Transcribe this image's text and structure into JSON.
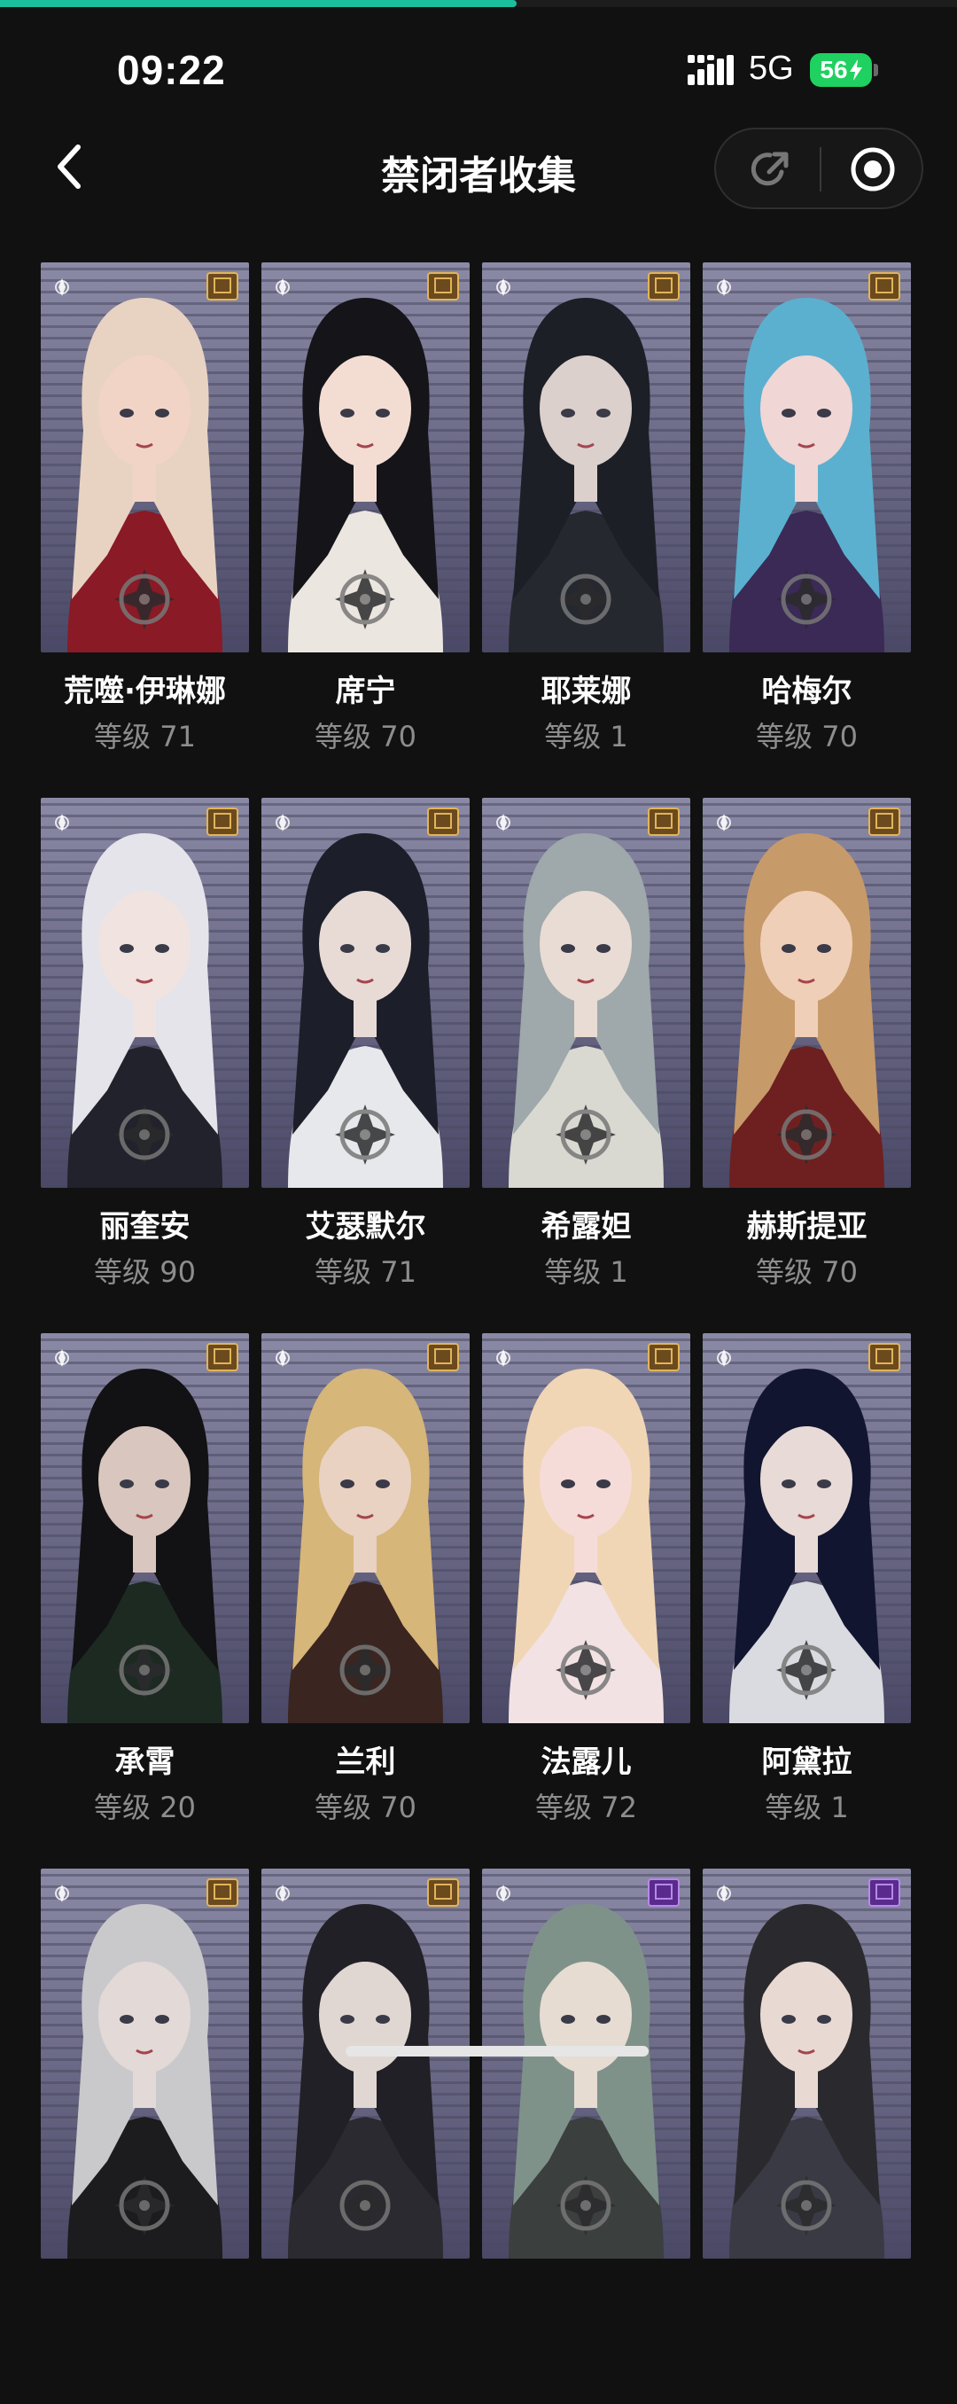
{
  "progress": {
    "value_percent": 60,
    "color": "#1bbf9c"
  },
  "status_bar": {
    "time": "09:22",
    "network": "5G",
    "battery": "56"
  },
  "header": {
    "title": "禁闭者收集",
    "back_icon": "chevron-left-icon",
    "share_icon": "share-icon",
    "record_icon": "record-icon"
  },
  "characters": [
    {
      "name": "荒噬·伊琳娜",
      "level": "等级 71",
      "hair": "#e8d3c2",
      "outfit": "#8a1a25",
      "skin": "#f2d4c6",
      "rank": "gold"
    },
    {
      "name": "席宁",
      "level": "等级 70",
      "hair": "#141419",
      "outfit": "#ece6e0",
      "skin": "#f3ddd2",
      "rank": "gold"
    },
    {
      "name": "耶莱娜",
      "level": "等级 1",
      "hair": "#1d1f27",
      "outfit": "#262830",
      "skin": "#dcd0cc",
      "rank": "gold"
    },
    {
      "name": "哈梅尔",
      "level": "等级 70",
      "hair": "#5bb0cf",
      "outfit": "#3a2a55",
      "skin": "#f0d6d4",
      "rank": "gold"
    },
    {
      "name": "丽奎安",
      "level": "等级 90",
      "hair": "#e4e4ea",
      "outfit": "#22222c",
      "skin": "#f1e3e0",
      "rank": "gold"
    },
    {
      "name": "艾瑟默尔",
      "level": "等级 71",
      "hair": "#1c1e2a",
      "outfit": "#e7e8ec",
      "skin": "#e8dbd6",
      "rank": "gold"
    },
    {
      "name": "希露妲",
      "level": "等级 1",
      "hair": "#9fa8aa",
      "outfit": "#d9d9d2",
      "skin": "#e9dcd4",
      "rank": "gold"
    },
    {
      "name": "赫斯提亚",
      "level": "等级 70",
      "hair": "#c79a6a",
      "outfit": "#6e2020",
      "skin": "#f0cfb8",
      "rank": "gold"
    },
    {
      "name": "承霄",
      "level": "等级 20",
      "hair": "#121214",
      "outfit": "#1d2a22",
      "skin": "#d9c7bf",
      "rank": "gold"
    },
    {
      "name": "兰利",
      "level": "等级 70",
      "hair": "#d6b679",
      "outfit": "#3a2520",
      "skin": "#e9d2c2",
      "rank": "gold"
    },
    {
      "name": "法露儿",
      "level": "等级 72",
      "hair": "#f0d6b4",
      "outfit": "#f2e2e4",
      "skin": "#f6dcd8",
      "rank": "gold"
    },
    {
      "name": "阿黛拉",
      "level": "等级 1",
      "hair": "#121530",
      "outfit": "#d9dbe0",
      "skin": "#e8dad6",
      "rank": "gold"
    },
    {
      "name": "",
      "level": "",
      "hair": "#c9c9cc",
      "outfit": "#1c1c1e",
      "skin": "#e3d9d6",
      "rank": "gold"
    },
    {
      "name": "",
      "level": "",
      "hair": "#202026",
      "outfit": "#2a2a30",
      "skin": "#e0d6d2",
      "rank": "gold"
    },
    {
      "name": "",
      "level": "",
      "hair": "#7f928a",
      "outfit": "#3b3f3e",
      "skin": "#e6dcd2",
      "rank": "purple"
    },
    {
      "name": "",
      "level": "",
      "hair": "#2a2a2e",
      "outfit": "#3a3a44",
      "skin": "#e8dad2",
      "rank": "purple"
    }
  ]
}
